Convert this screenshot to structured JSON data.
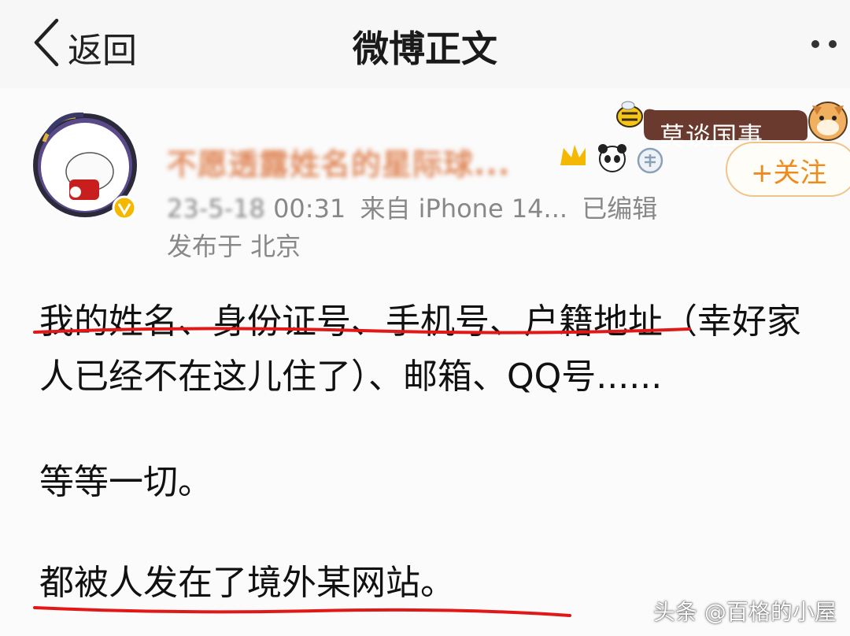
{
  "nav": {
    "back_label": "返回",
    "title": "微博正文"
  },
  "post": {
    "username": "不愿透露姓名的星际球...",
    "topic_tag": "莫谈国事",
    "follow_label": "+关注",
    "time_prefix": "23-5-18",
    "time": "00:31",
    "source": "来自 iPhone 14...",
    "edited": "已编辑",
    "location": "发布于 北京",
    "content_lines": [
      "我的姓名、身份证号、手机号、户籍地址（幸好家",
      "人已经不在这儿住了）、邮箱、QQ号......",
      "等等一切。",
      "都被人发在了境外某网站。"
    ]
  },
  "watermark": "头条 @百格的小屋",
  "colors": {
    "accent": "#f08a1c",
    "highlight": "#e01818",
    "username": "#e08a5c"
  }
}
